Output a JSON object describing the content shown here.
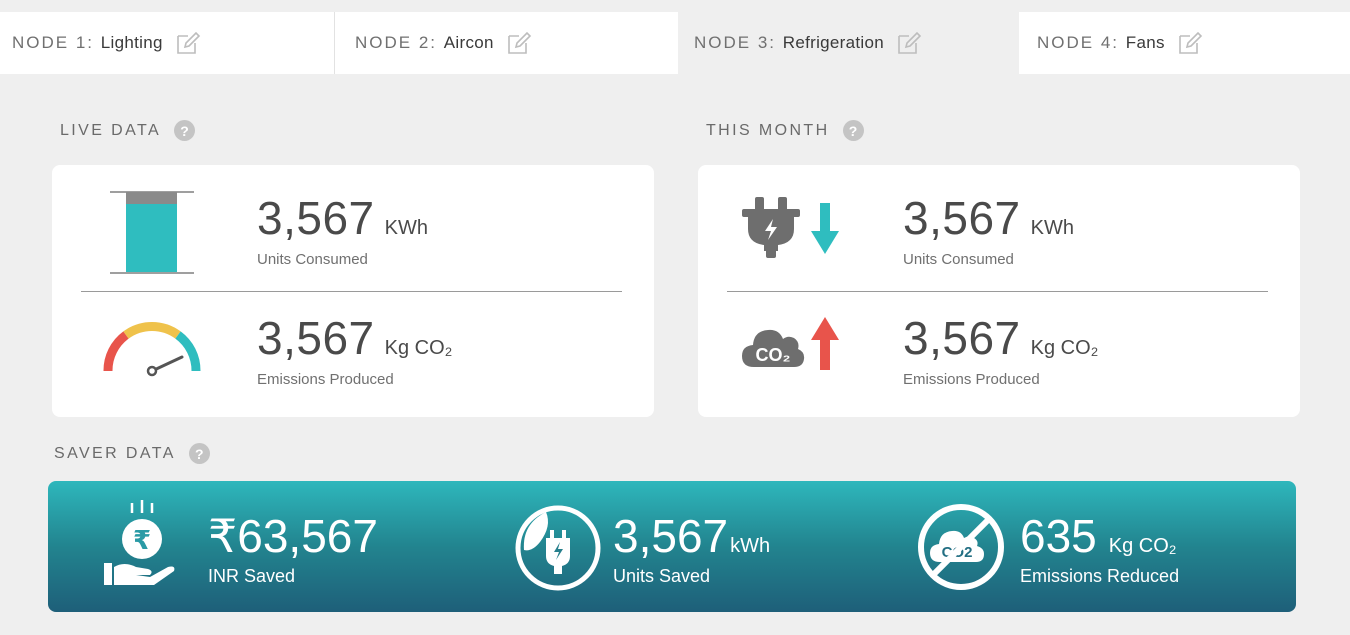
{
  "tabs": [
    {
      "prefix": "NODE 1:",
      "name": "Lighting",
      "active": false
    },
    {
      "prefix": "NODE 2:",
      "name": "Aircon",
      "active": false
    },
    {
      "prefix": "NODE 3:",
      "name": "Refrigeration",
      "active": true
    },
    {
      "prefix": "NODE 4:",
      "name": "Fans",
      "active": false
    }
  ],
  "live": {
    "title": "LIVE DATA",
    "help": "?",
    "consumed": {
      "value": "3,567",
      "unit": "KWh",
      "label": "Units Consumed"
    },
    "emissions": {
      "value": "3,567",
      "unit": "Kg CO₂",
      "label": "Emissions Produced"
    }
  },
  "month": {
    "title": "THIS MONTH",
    "help": "?",
    "consumed": {
      "value": "3,567",
      "unit": "KWh",
      "label": "Units Consumed"
    },
    "emissions": {
      "value": "3,567",
      "unit": "Kg CO₂",
      "label": "Emissions Produced"
    },
    "cloud_text": "CO₂"
  },
  "saver": {
    "title": "SAVER DATA",
    "help": "?",
    "inr": {
      "value": "₹63,567",
      "label": "INR Saved",
      "icon_symbol": "₹"
    },
    "units": {
      "value": "3,567",
      "unit": "kWh",
      "label": "Units Saved"
    },
    "emissions": {
      "value": "635",
      "unit": "Kg CO₂",
      "label": "Emissions Reduced",
      "icon_text": "CO2"
    }
  },
  "icons": {
    "edit": "edit-pencil-icon",
    "battery": "battery-level-icon",
    "gauge": "gauge-icon",
    "plug": "plug-icon",
    "arrow_down": "arrow-down-icon",
    "arrow_up": "arrow-up-icon",
    "cloud": "co2-cloud-icon",
    "rupee_hand": "rupee-hand-icon",
    "leaf_plug": "leaf-plug-icon",
    "no_co2": "no-co2-icon"
  },
  "colors": {
    "teal": "#2fbdbf",
    "red": "#e8544b",
    "yellow": "#efc24b",
    "gray_icon": "#6e6e6e",
    "banner_top": "#2eb7bc",
    "banner_bottom": "#1e5f79"
  }
}
